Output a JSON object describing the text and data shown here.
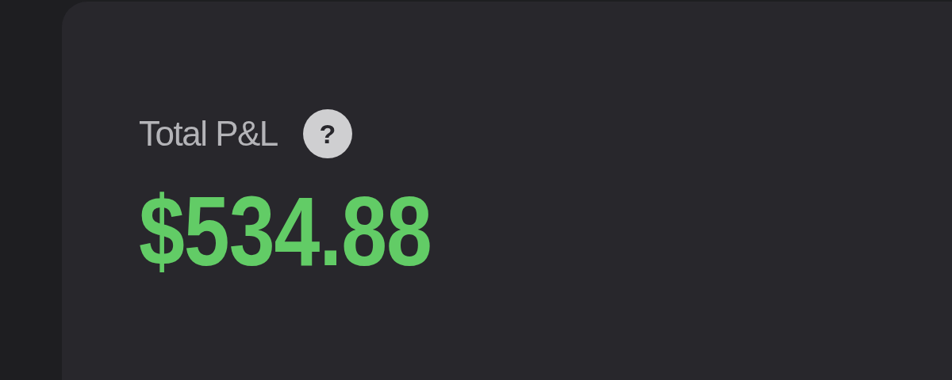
{
  "card": {
    "label": "Total P&L",
    "help_icon": "?",
    "value": "$534.88"
  }
}
